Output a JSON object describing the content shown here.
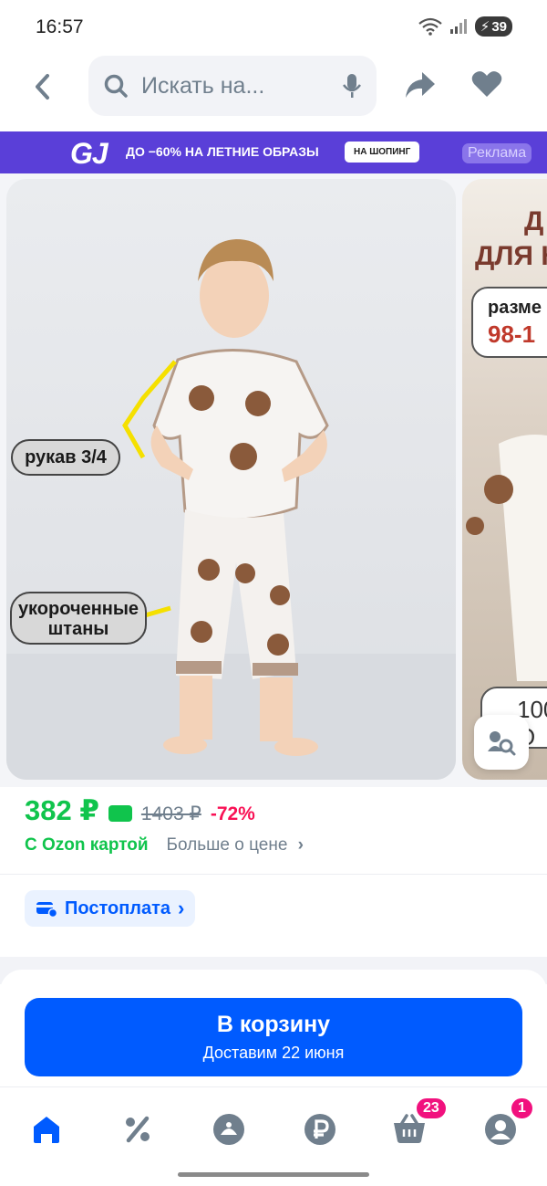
{
  "status_bar": {
    "time": "16:57",
    "battery": "39"
  },
  "header": {
    "search_placeholder": "Искать на..."
  },
  "promo": {
    "logo": "GJ",
    "text": "ДО −60% НА ЛЕТНИЕ ОБРАЗЫ",
    "button": "НА ШОПИНГ",
    "ad_label": "Реклама"
  },
  "gallery": {
    "main_labels": {
      "sleeve": "рукав 3/4",
      "pants_line1": "укороченные",
      "pants_line2": "штаны"
    },
    "side_labels": {
      "title_top": "Д",
      "title": "ДЛЯ Н",
      "size_label": "разме",
      "size_value": "98-1",
      "bottom_line1": "100",
      "bottom_line2": "О"
    }
  },
  "price": {
    "current": "382 ₽",
    "old": "1403 ₽",
    "discount": "-72%",
    "ozon_card": "С Ozon картой",
    "more": "Больше о цене",
    "postpay": "Постоплата"
  },
  "cart": {
    "label": "В корзину",
    "delivery": "Доставим 22 июня"
  },
  "nav": {
    "cart_badge": "23",
    "profile_badge": "1"
  },
  "colors": {
    "brand_blue": "#005bff",
    "price_green": "#10c44c",
    "discount_red": "#f91155",
    "promo_purple": "#5a3fd8",
    "badge_pink": "#f1117e"
  }
}
